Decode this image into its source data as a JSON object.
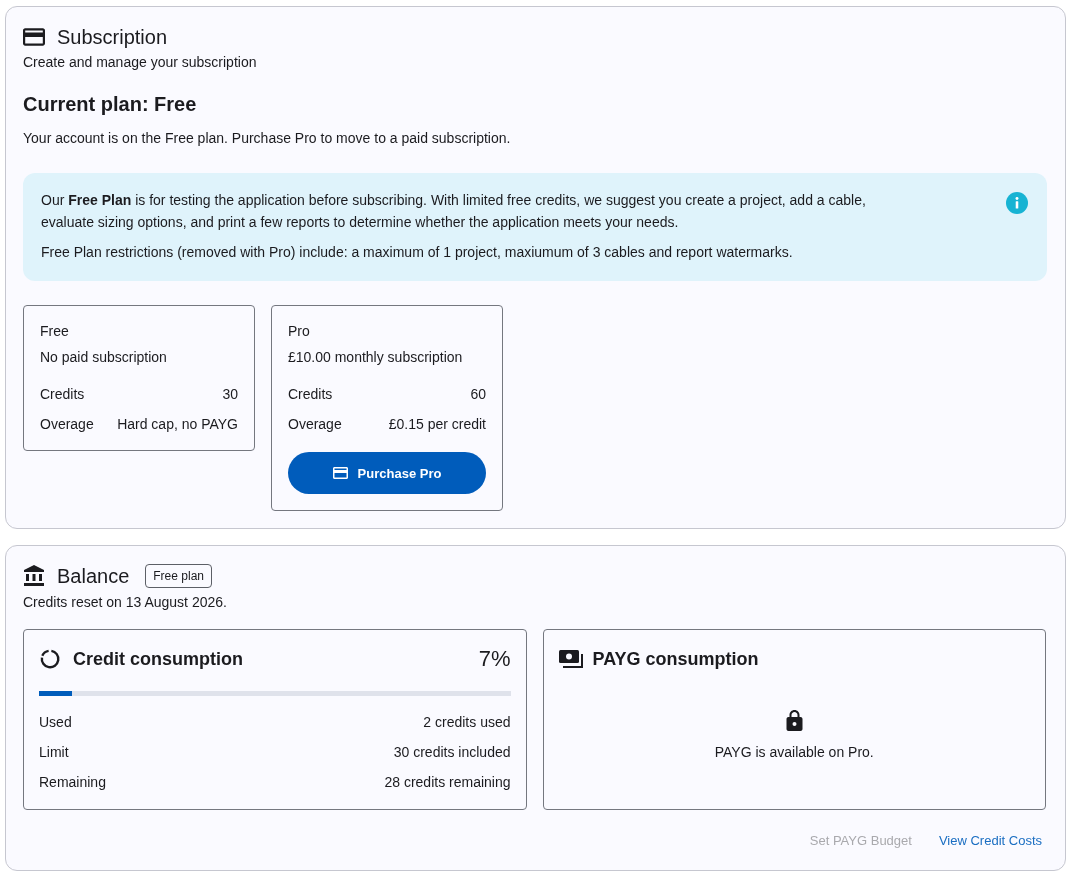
{
  "subscription": {
    "title": "Subscription",
    "subtitle": "Create and manage your subscription",
    "current_plan": "Current plan: Free",
    "description": "Your account is on the Free plan. Purchase Pro to move to a paid subscription.",
    "info": {
      "paragraphs": [
        "Our **Free Plan** is for testing the application before subscribing. With limited free credits, we suggest you create a project, add a cable, evaluate sizing options, and print a few reports to determine whether the application meets your needs.",
        "Free Plan restrictions (removed with Pro) include: a maximum of 1 project, maxiumum of 3 cables and report watermarks."
      ]
    },
    "plans": [
      {
        "name": "Free",
        "subtitle": "No paid subscription",
        "rows": [
          {
            "label": "Credits",
            "value": "30"
          },
          {
            "label": "Overage",
            "value": "Hard cap, no PAYG"
          }
        ]
      },
      {
        "name": "Pro",
        "subtitle": "£10.00 monthly subscription",
        "rows": [
          {
            "label": "Credits",
            "value": "60"
          },
          {
            "label": "Overage",
            "value": "£0.15 per credit"
          }
        ],
        "button": "Purchase Pro"
      }
    ]
  },
  "balance": {
    "title": "Balance",
    "badge": "Free plan",
    "reset_note": "Credits reset on 13 August 2026.",
    "credit": {
      "title": "Credit consumption",
      "percent": "7%",
      "level": 0.07,
      "rows": [
        {
          "label": "Used",
          "value": "2 credits used"
        },
        {
          "label": "Limit",
          "value": "30 credits included"
        },
        {
          "label": "Remaining",
          "value": "28 credits remaining"
        }
      ]
    },
    "payg": {
      "title": "PAYG consumption",
      "message": "PAYG is available on Pro."
    },
    "actions": [
      {
        "label": "Set PAYG Budget",
        "disabled": true
      },
      {
        "label": "View Credit Costs",
        "disabled": false
      }
    ]
  }
}
